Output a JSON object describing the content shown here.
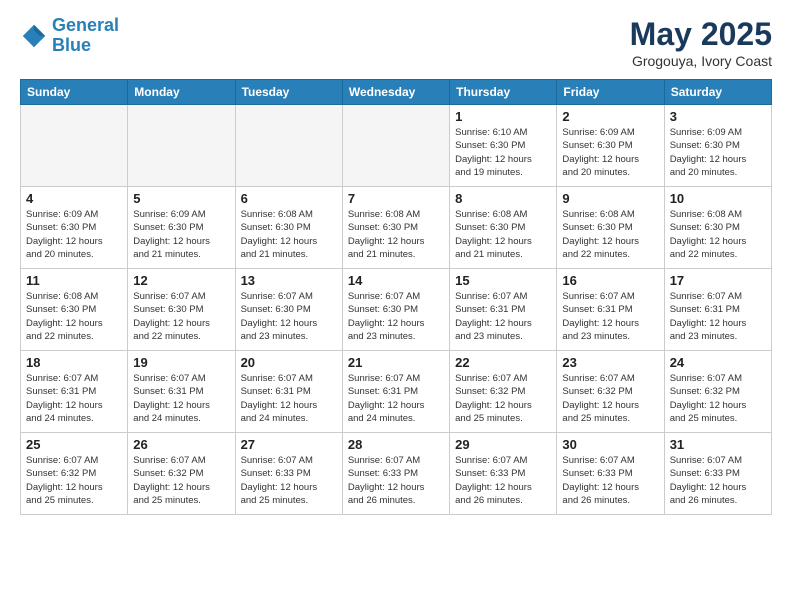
{
  "header": {
    "logo_line1": "General",
    "logo_line2": "Blue",
    "month": "May 2025",
    "location": "Grogouya, Ivory Coast"
  },
  "days_of_week": [
    "Sunday",
    "Monday",
    "Tuesday",
    "Wednesday",
    "Thursday",
    "Friday",
    "Saturday"
  ],
  "weeks": [
    [
      {
        "day": "",
        "info": ""
      },
      {
        "day": "",
        "info": ""
      },
      {
        "day": "",
        "info": ""
      },
      {
        "day": "",
        "info": ""
      },
      {
        "day": "1",
        "info": "Sunrise: 6:10 AM\nSunset: 6:30 PM\nDaylight: 12 hours\nand 19 minutes."
      },
      {
        "day": "2",
        "info": "Sunrise: 6:09 AM\nSunset: 6:30 PM\nDaylight: 12 hours\nand 20 minutes."
      },
      {
        "day": "3",
        "info": "Sunrise: 6:09 AM\nSunset: 6:30 PM\nDaylight: 12 hours\nand 20 minutes."
      }
    ],
    [
      {
        "day": "4",
        "info": "Sunrise: 6:09 AM\nSunset: 6:30 PM\nDaylight: 12 hours\nand 20 minutes."
      },
      {
        "day": "5",
        "info": "Sunrise: 6:09 AM\nSunset: 6:30 PM\nDaylight: 12 hours\nand 21 minutes."
      },
      {
        "day": "6",
        "info": "Sunrise: 6:08 AM\nSunset: 6:30 PM\nDaylight: 12 hours\nand 21 minutes."
      },
      {
        "day": "7",
        "info": "Sunrise: 6:08 AM\nSunset: 6:30 PM\nDaylight: 12 hours\nand 21 minutes."
      },
      {
        "day": "8",
        "info": "Sunrise: 6:08 AM\nSunset: 6:30 PM\nDaylight: 12 hours\nand 21 minutes."
      },
      {
        "day": "9",
        "info": "Sunrise: 6:08 AM\nSunset: 6:30 PM\nDaylight: 12 hours\nand 22 minutes."
      },
      {
        "day": "10",
        "info": "Sunrise: 6:08 AM\nSunset: 6:30 PM\nDaylight: 12 hours\nand 22 minutes."
      }
    ],
    [
      {
        "day": "11",
        "info": "Sunrise: 6:08 AM\nSunset: 6:30 PM\nDaylight: 12 hours\nand 22 minutes."
      },
      {
        "day": "12",
        "info": "Sunrise: 6:07 AM\nSunset: 6:30 PM\nDaylight: 12 hours\nand 22 minutes."
      },
      {
        "day": "13",
        "info": "Sunrise: 6:07 AM\nSunset: 6:30 PM\nDaylight: 12 hours\nand 23 minutes."
      },
      {
        "day": "14",
        "info": "Sunrise: 6:07 AM\nSunset: 6:30 PM\nDaylight: 12 hours\nand 23 minutes."
      },
      {
        "day": "15",
        "info": "Sunrise: 6:07 AM\nSunset: 6:31 PM\nDaylight: 12 hours\nand 23 minutes."
      },
      {
        "day": "16",
        "info": "Sunrise: 6:07 AM\nSunset: 6:31 PM\nDaylight: 12 hours\nand 23 minutes."
      },
      {
        "day": "17",
        "info": "Sunrise: 6:07 AM\nSunset: 6:31 PM\nDaylight: 12 hours\nand 23 minutes."
      }
    ],
    [
      {
        "day": "18",
        "info": "Sunrise: 6:07 AM\nSunset: 6:31 PM\nDaylight: 12 hours\nand 24 minutes."
      },
      {
        "day": "19",
        "info": "Sunrise: 6:07 AM\nSunset: 6:31 PM\nDaylight: 12 hours\nand 24 minutes."
      },
      {
        "day": "20",
        "info": "Sunrise: 6:07 AM\nSunset: 6:31 PM\nDaylight: 12 hours\nand 24 minutes."
      },
      {
        "day": "21",
        "info": "Sunrise: 6:07 AM\nSunset: 6:31 PM\nDaylight: 12 hours\nand 24 minutes."
      },
      {
        "day": "22",
        "info": "Sunrise: 6:07 AM\nSunset: 6:32 PM\nDaylight: 12 hours\nand 25 minutes."
      },
      {
        "day": "23",
        "info": "Sunrise: 6:07 AM\nSunset: 6:32 PM\nDaylight: 12 hours\nand 25 minutes."
      },
      {
        "day": "24",
        "info": "Sunrise: 6:07 AM\nSunset: 6:32 PM\nDaylight: 12 hours\nand 25 minutes."
      }
    ],
    [
      {
        "day": "25",
        "info": "Sunrise: 6:07 AM\nSunset: 6:32 PM\nDaylight: 12 hours\nand 25 minutes."
      },
      {
        "day": "26",
        "info": "Sunrise: 6:07 AM\nSunset: 6:32 PM\nDaylight: 12 hours\nand 25 minutes."
      },
      {
        "day": "27",
        "info": "Sunrise: 6:07 AM\nSunset: 6:33 PM\nDaylight: 12 hours\nand 25 minutes."
      },
      {
        "day": "28",
        "info": "Sunrise: 6:07 AM\nSunset: 6:33 PM\nDaylight: 12 hours\nand 26 minutes."
      },
      {
        "day": "29",
        "info": "Sunrise: 6:07 AM\nSunset: 6:33 PM\nDaylight: 12 hours\nand 26 minutes."
      },
      {
        "day": "30",
        "info": "Sunrise: 6:07 AM\nSunset: 6:33 PM\nDaylight: 12 hours\nand 26 minutes."
      },
      {
        "day": "31",
        "info": "Sunrise: 6:07 AM\nSunset: 6:33 PM\nDaylight: 12 hours\nand 26 minutes."
      }
    ]
  ]
}
